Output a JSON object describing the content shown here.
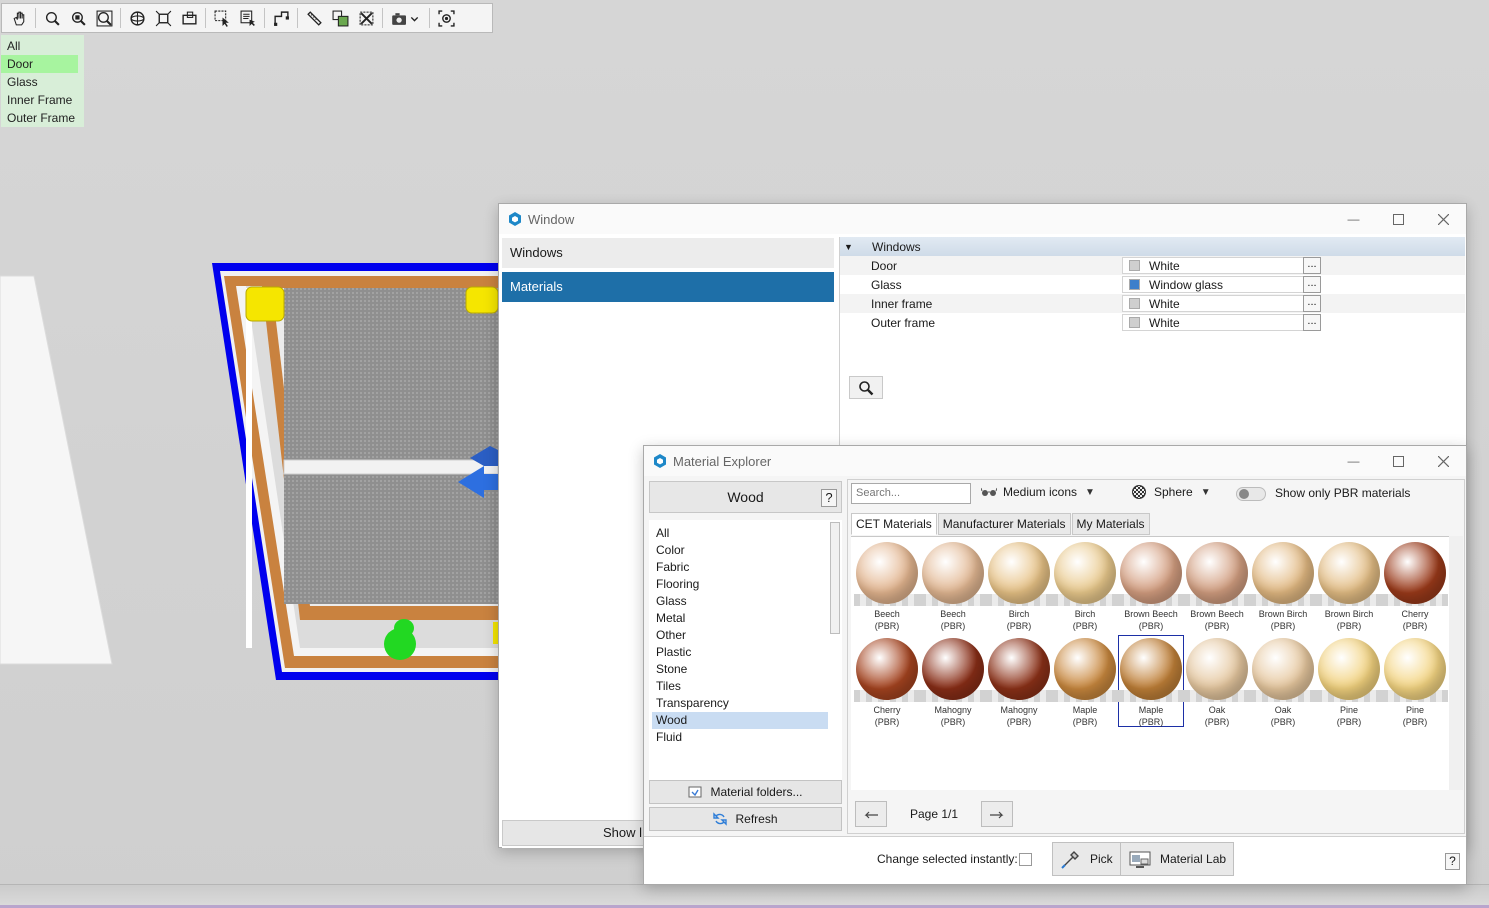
{
  "layers": {
    "items": [
      "All",
      "Door",
      "Glass",
      "Inner Frame",
      "Outer Frame"
    ],
    "selected": "Door"
  },
  "toolbar": {
    "icons": [
      "pan-icon",
      "zoom-icon",
      "zoom-window-icon",
      "zoom-extents-icon",
      "orbit-icon",
      "fit-icon",
      "view-icon",
      "select-icon",
      "select-list-icon",
      "layout-icon",
      "measure-icon",
      "copy-icon",
      "delete-icon",
      "camera-dropdown-icon",
      "snapshot-icon"
    ]
  },
  "window_dialog": {
    "title": "Window",
    "nav": [
      {
        "label": "Windows"
      },
      {
        "label": "Materials"
      }
    ],
    "active_nav": "Materials",
    "show_button": "Show l",
    "group": "Windows",
    "properties": [
      {
        "name": "Door",
        "value": "White",
        "swatch": "#cfcfcf"
      },
      {
        "name": "Glass",
        "value": "Window glass",
        "swatch": "#3d7fcb"
      },
      {
        "name": "Inner frame",
        "value": "White",
        "swatch": "#cfcfcf"
      },
      {
        "name": "Outer frame",
        "value": "White",
        "swatch": "#cfcfcf"
      }
    ],
    "dots_label": "..."
  },
  "material_explorer": {
    "title": "Material Explorer",
    "category_title": "Wood",
    "help_label": "?",
    "categories": [
      "All",
      "Color",
      "Fabric",
      "Flooring",
      "Glass",
      "Metal",
      "Other",
      "Plastic",
      "Stone",
      "Tiles",
      "Transparency",
      "Wood",
      "Fluid"
    ],
    "selected_category": "Wood",
    "material_folders_label": "Material folders...",
    "refresh_label": "Refresh",
    "search_placeholder": "Search...",
    "view_mode": "Medium icons",
    "shape": "Sphere",
    "pbr_label": "Show only PBR materials",
    "pbr_on": false,
    "tabs": [
      "CET Materials",
      "Manufacturer Materials",
      "My Materials"
    ],
    "active_tab": "CET Materials",
    "materials": [
      {
        "name": "Beech",
        "sub": "(PBR)",
        "color": "#e3b58f"
      },
      {
        "name": "Beech",
        "sub": "(PBR)",
        "color": "#e2b792"
      },
      {
        "name": "Birch",
        "sub": "(PBR)",
        "color": "#e7c286"
      },
      {
        "name": "Birch",
        "sub": "(PBR)",
        "color": "#e9c98c"
      },
      {
        "name": "Brown Beech",
        "sub": "(PBR)",
        "color": "#d49e80"
      },
      {
        "name": "Brown Beech",
        "sub": "(PBR)",
        "color": "#d29e80"
      },
      {
        "name": "Brown Birch",
        "sub": "(PBR)",
        "color": "#e2b982"
      },
      {
        "name": "Brown Birch",
        "sub": "(PBR)",
        "color": "#e3bd84"
      },
      {
        "name": "Cherry",
        "sub": "(PBR)",
        "color": "#9b3a1a"
      },
      {
        "name": "Cherry",
        "sub": "(PBR)",
        "color": "#a64420"
      },
      {
        "name": "Mahogny",
        "sub": "(PBR)",
        "color": "#8a2e17"
      },
      {
        "name": "Mahogny",
        "sub": "(PBR)",
        "color": "#8c3118"
      },
      {
        "name": "Maple",
        "sub": "(PBR)",
        "color": "#c9883e"
      },
      {
        "name": "Maple",
        "sub": "(PBR)",
        "color": "#c08038"
      },
      {
        "name": "Oak",
        "sub": "(PBR)",
        "color": "#e5c79f"
      },
      {
        "name": "Oak",
        "sub": "(PBR)",
        "color": "#e6c79e"
      },
      {
        "name": "Pine",
        "sub": "(PBR)",
        "color": "#f2d27e"
      },
      {
        "name": "Pine",
        "sub": "(PBR)",
        "color": "#f4d582"
      }
    ],
    "selected_index": 13,
    "page_label": "Page 1/1",
    "change_instantly_label": "Change selected instantly:",
    "change_instantly": false,
    "pick_label": "Pick",
    "material_lab_label": "Material Lab"
  }
}
